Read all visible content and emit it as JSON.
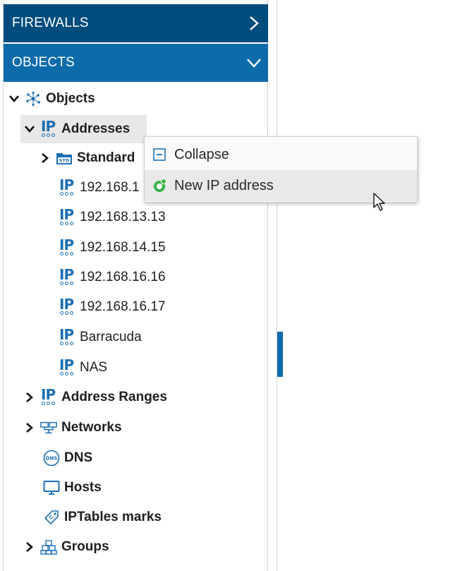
{
  "sidebar": {
    "firewalls_label": "FIREWALLS",
    "objects_label": "OBJECTS"
  },
  "tree": {
    "objects": "Objects",
    "addresses": "Addresses",
    "standard": "Standard",
    "ip1": "192.168.1",
    "ip2": "192.168.13.13",
    "ip3": "192.168.14.15",
    "ip4": "192.168.16.16",
    "ip5": "192.168.16.17",
    "ip6": "Barracuda",
    "ip7": "NAS",
    "address_ranges": "Address Ranges",
    "networks": "Networks",
    "dns": "DNS",
    "hosts": "Hosts",
    "iptables_marks": "IPTables marks",
    "groups": "Groups",
    "std_badge": "STD",
    "dns_badge": "DNS"
  },
  "context_menu": {
    "collapse": "Collapse",
    "new_ip_address": "New IP address"
  },
  "colors": {
    "header_dark": "#004c7d",
    "header_active": "#0e6bab",
    "icon_blue": "#1e6fb5",
    "new_icon_green": "#3cb04a"
  }
}
